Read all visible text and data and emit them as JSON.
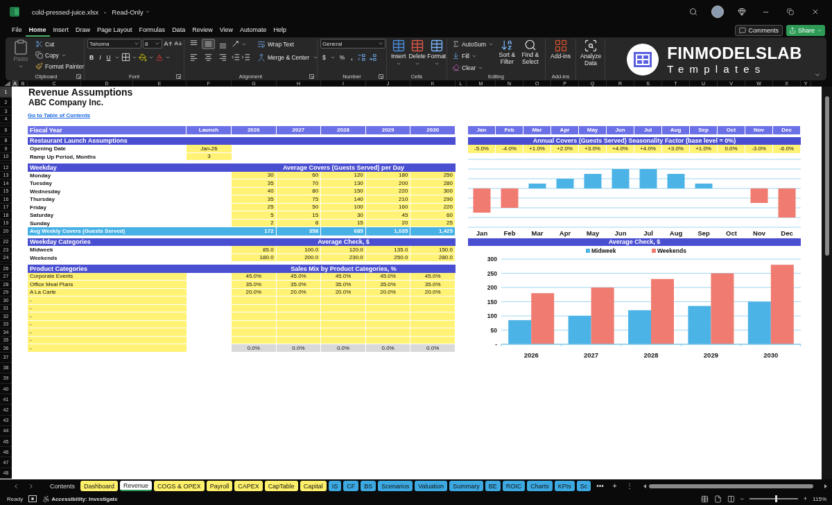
{
  "window": {
    "file_name": "cold-pressed-juice.xlsx",
    "separator": "-",
    "mode": "Read-Only"
  },
  "menu_tabs": [
    {
      "label": "File",
      "selected": false
    },
    {
      "label": "Home",
      "selected": true
    },
    {
      "label": "Insert",
      "selected": false
    },
    {
      "label": "Draw",
      "selected": false
    },
    {
      "label": "Page Layout",
      "selected": false
    },
    {
      "label": "Formulas",
      "selected": false
    },
    {
      "label": "Data",
      "selected": false
    },
    {
      "label": "Review",
      "selected": false
    },
    {
      "label": "View",
      "selected": false
    },
    {
      "label": "Automate",
      "selected": false
    },
    {
      "label": "Help",
      "selected": false
    }
  ],
  "actions": {
    "comments": "Comments",
    "share": "Share"
  },
  "ribbon": {
    "clipboard": {
      "paste": {
        "label": "Paste",
        "disabled": true
      },
      "cut": "Cut",
      "copy": "Copy",
      "format_painter": "Format Painter",
      "label": "Clipboard"
    },
    "font": {
      "name": "Tahoma",
      "size": "8",
      "bold": "B",
      "italic": "I",
      "underline": "U",
      "label": "Font"
    },
    "alignment": {
      "buttons": [
        {
          "kind": "top",
          "selected": false
        },
        {
          "kind": "middle",
          "selected": true
        },
        {
          "kind": "bottom",
          "selected": false
        },
        {
          "kind": "left",
          "selected": false
        },
        {
          "kind": "center",
          "selected": false
        },
        {
          "kind": "right",
          "selected": false
        }
      ],
      "wrap_text": "Wrap Text",
      "merge_center": "Merge & Center",
      "label": "Alignment"
    },
    "number": {
      "format": "General",
      "currency": "$",
      "percent": "%",
      "comma": ",",
      "label": "Number"
    },
    "cells": {
      "insert": "Insert",
      "delete": "Delete",
      "format": "Format",
      "label": "Cells"
    },
    "editing": {
      "autosum": "AutoSum",
      "fill": "Fill",
      "clear": "Clear",
      "sort": "Sort & Filter",
      "find": "Find & Select",
      "label": "Editing"
    },
    "addins": {
      "button": "Add-ins",
      "label": "Add-ins"
    },
    "analyze": "Analyze Data"
  },
  "brand": {
    "name": "FINMODELSLAB",
    "tagline": "Templates"
  },
  "column_headers": [
    {
      "label": "A",
      "selected": true
    },
    {
      "label": "B",
      "selected": false
    },
    {
      "label": "C",
      "selected": false
    },
    {
      "label": "D",
      "selected": false
    },
    {
      "label": "E",
      "selected": false
    },
    {
      "label": "F",
      "selected": false
    },
    {
      "label": "G",
      "selected": false
    },
    {
      "label": "H",
      "selected": false
    },
    {
      "label": "I",
      "selected": false
    },
    {
      "label": "J",
      "selected": false
    },
    {
      "label": "K",
      "selected": false
    },
    {
      "label": "L",
      "selected": false
    },
    {
      "label": "M",
      "selected": false
    },
    {
      "label": "N",
      "selected": false
    },
    {
      "label": "O",
      "selected": false
    },
    {
      "label": "P",
      "selected": false
    },
    {
      "label": "Q",
      "selected": false
    },
    {
      "label": "R",
      "selected": false
    },
    {
      "label": "S",
      "selected": false
    },
    {
      "label": "T",
      "selected": false
    },
    {
      "label": "U",
      "selected": false
    },
    {
      "label": "V",
      "selected": false
    },
    {
      "label": "W",
      "selected": false
    },
    {
      "label": "X",
      "selected": false
    },
    {
      "label": "Y",
      "selected": false
    }
  ],
  "rows": [
    {
      "kind": "title",
      "number": "1",
      "selected": true
    },
    {
      "kind": "subtitle",
      "number": "2",
      "selected": false
    },
    {
      "kind": "normal",
      "number": "3",
      "selected": false
    },
    {
      "kind": "normal",
      "number": "4",
      "selected": false
    },
    {
      "kind": "spacer",
      "selected": false
    },
    {
      "kind": "normal",
      "number": "6",
      "selected": false
    },
    {
      "kind": "spacer",
      "selected": false
    },
    {
      "kind": "normal",
      "number": "8",
      "selected": false
    },
    {
      "kind": "normal",
      "number": "9",
      "selected": false
    },
    {
      "kind": "normal",
      "number": "10",
      "selected": false
    },
    {
      "kind": "spacer",
      "selected": false
    },
    {
      "kind": "normal",
      "number": "12",
      "selected": false
    },
    {
      "kind": "normal",
      "number": "13",
      "selected": false
    },
    {
      "kind": "normal",
      "number": "14",
      "selected": false
    },
    {
      "kind": "normal",
      "number": "15",
      "selected": false
    },
    {
      "kind": "normal",
      "number": "16",
      "selected": false
    },
    {
      "kind": "normal",
      "number": "17",
      "selected": false
    },
    {
      "kind": "normal",
      "number": "18",
      "selected": false
    },
    {
      "kind": "normal",
      "number": "19",
      "selected": false
    },
    {
      "kind": "normal",
      "number": "20",
      "selected": false
    },
    {
      "kind": "spacer",
      "selected": false
    },
    {
      "kind": "normal",
      "number": "22",
      "selected": false
    },
    {
      "kind": "normal",
      "number": "23",
      "selected": false
    },
    {
      "kind": "normal",
      "number": "24",
      "selected": false
    },
    {
      "kind": "spacer",
      "selected": false
    },
    {
      "kind": "normal",
      "number": "26",
      "selected": false
    },
    {
      "kind": "normal",
      "number": "27",
      "selected": false
    },
    {
      "kind": "normal",
      "number": "28",
      "selected": false
    },
    {
      "kind": "normal",
      "number": "29",
      "selected": false
    },
    {
      "kind": "normal",
      "number": "30",
      "selected": false
    },
    {
      "kind": "normal",
      "number": "31",
      "selected": false
    },
    {
      "kind": "normal",
      "number": "32",
      "selected": false
    },
    {
      "kind": "normal",
      "number": "33",
      "selected": false
    },
    {
      "kind": "normal",
      "number": "34",
      "selected": false
    },
    {
      "kind": "normal",
      "number": "35",
      "selected": false
    },
    {
      "kind": "normal",
      "number": "36",
      "selected": false
    },
    {
      "kind": "tall",
      "number": "37",
      "selected": false
    },
    {
      "kind": "tall",
      "number": "38",
      "selected": false
    },
    {
      "kind": "tall",
      "number": "39",
      "selected": false
    },
    {
      "kind": "tall",
      "number": "40",
      "selected": false
    },
    {
      "kind": "tall",
      "number": "41",
      "selected": false
    },
    {
      "kind": "tall",
      "number": "42",
      "selected": false
    },
    {
      "kind": "tall",
      "number": "43",
      "selected": false
    },
    {
      "kind": "tall",
      "number": "44",
      "selected": false
    },
    {
      "kind": "tall",
      "number": "45",
      "selected": false
    },
    {
      "kind": "tall",
      "number": "46",
      "selected": false
    },
    {
      "kind": "tall",
      "number": "47",
      "selected": false
    },
    {
      "kind": "tall",
      "number": "48",
      "selected": false
    }
  ],
  "sheet": {
    "title": "Revenue Assumptions",
    "company": "ABC Company Inc.",
    "toc_link": "Go to Table of Contents",
    "fiscal_header": {
      "label": "Fiscal Year",
      "launch": "Launch",
      "years": [
        "2026",
        "2027",
        "2028",
        "2029",
        "2030"
      ]
    },
    "launch": {
      "title": "Restaurant Launch Assumptions",
      "items": [
        {
          "label": "Opening Date",
          "value": "Jan-26"
        },
        {
          "label": "Ramp Up Period, Months",
          "value": "3"
        }
      ]
    },
    "covers": {
      "title": "Weekday",
      "heading": "Average Covers (Guests Served) per Day",
      "rows": [
        {
          "label": "Monday",
          "values": [
            "30",
            "60",
            "120",
            "180",
            "250"
          ]
        },
        {
          "label": "Tuesday",
          "values": [
            "35",
            "70",
            "130",
            "200",
            "280"
          ]
        },
        {
          "label": "Wednesday",
          "values": [
            "40",
            "80",
            "150",
            "220",
            "300"
          ]
        },
        {
          "label": "Thursday",
          "values": [
            "35",
            "75",
            "140",
            "210",
            "290"
          ]
        },
        {
          "label": "Friday",
          "values": [
            "25",
            "50",
            "100",
            "160",
            "220"
          ]
        },
        {
          "label": "Saturday",
          "values": [
            "5",
            "15",
            "30",
            "45",
            "60"
          ]
        },
        {
          "label": "Sunday",
          "values": [
            "2",
            "8",
            "15",
            "20",
            "25"
          ]
        }
      ],
      "total": {
        "label": "Avg Weekly Covers (Guests Served)",
        "values": [
          "172",
          "358",
          "685",
          "1,035",
          "1,425"
        ]
      }
    },
    "check": {
      "title": "Weekday Categories",
      "heading": "Average Check, $",
      "rows": [
        {
          "label": "Midweek",
          "values": [
            "85.0",
            "100.0",
            "120.0",
            "135.0",
            "150.0"
          ]
        },
        {
          "label": "Weekends",
          "values": [
            "180.0",
            "200.0",
            "230.0",
            "250.0",
            "280.0"
          ]
        }
      ]
    },
    "mix": {
      "title": "Product Categories",
      "heading": "Sales Mix by Product Categories, %",
      "rows": [
        {
          "label": "Corporate Events",
          "values": [
            "45.0%",
            "45.0%",
            "45.0%",
            "45.0%",
            "45.0%"
          ]
        },
        {
          "label": "Office Meal Plans",
          "values": [
            "35.0%",
            "35.0%",
            "35.0%",
            "35.0%",
            "35.0%"
          ]
        },
        {
          "label": "A La Carte",
          "values": [
            "20.0%",
            "20.0%",
            "20.0%",
            "20.0%",
            "20.0%"
          ]
        },
        {
          "label": "-"
        },
        {
          "label": "-"
        },
        {
          "label": "-"
        },
        {
          "label": "-"
        },
        {
          "label": "-"
        },
        {
          "label": "-"
        }
      ],
      "total_row": {
        "label": "-",
        "values": [
          "0.0%",
          "0.0%",
          "0.0%",
          "0.0%",
          "0.0%"
        ]
      }
    }
  },
  "seasonality": {
    "months": [
      "Jan",
      "Feb",
      "Mar",
      "Apr",
      "May",
      "Jun",
      "Jul",
      "Aug",
      "Sep",
      "Oct",
      "Nov",
      "Dec"
    ],
    "title": "Annual Covers (Guests Served) Seasonality Factor (base level = 0%)",
    "factors": [
      "-5.0%",
      "-4.0%",
      "+1.0%",
      "+2.0%",
      "+3.0%",
      "+4.0%",
      "+4.0%",
      "+3.0%",
      "+1.0%",
      "0.0%",
      "-3.0%",
      "-6.0%"
    ],
    "chart_labels": [
      "Jan",
      "Feb",
      "Mar",
      "Apr",
      "May",
      "Jun",
      "Jul",
      "Aug",
      "Sep",
      "Oct",
      "Nov",
      "Dec"
    ]
  },
  "avg_check_chart": {
    "title": "Average Check, $",
    "chart_data": {
      "type": "bar",
      "categories": [
        "2026",
        "2027",
        "2028",
        "2029",
        "2030"
      ],
      "series": [
        {
          "name": "Midweek",
          "color": "#4cb3e6",
          "values": [
            85,
            100,
            120,
            135,
            150
          ]
        },
        {
          "name": "Weekends",
          "color": "#f07b70",
          "values": [
            180,
            200,
            230,
            250,
            280
          ]
        }
      ],
      "ylim": [
        0,
        300
      ],
      "grid": true,
      "legend": true,
      "yticks": [
        {
          "value": 0,
          "label": "-"
        },
        50,
        100,
        150,
        200,
        250,
        300
      ]
    }
  },
  "sheet_tabs": [
    {
      "label": "Contents",
      "selected": false
    },
    {
      "label": "Dashboard",
      "color": "#fff06b",
      "selected": false
    },
    {
      "label": "Revenue",
      "selected": true
    },
    {
      "label": "COGS & OPEX",
      "color": "#fff06b",
      "selected": false
    },
    {
      "label": "Payroll",
      "color": "#fff06b",
      "selected": false
    },
    {
      "label": "CAPEX",
      "color": "#fff06b",
      "selected": false
    },
    {
      "label": "CapTable",
      "color": "#fff06b",
      "selected": false
    },
    {
      "label": "Capital",
      "color": "#fff06b",
      "selected": false
    },
    {
      "label": "IS",
      "color": "#3ca9e2",
      "selected": false
    },
    {
      "label": "CF",
      "color": "#3ca9e2",
      "selected": false
    },
    {
      "label": "BS",
      "color": "#3ca9e2",
      "selected": false
    },
    {
      "label": "Scenarios",
      "color": "#3ca9e2",
      "selected": false
    },
    {
      "label": "Valuation",
      "color": "#3ca9e2",
      "selected": false
    },
    {
      "label": "Summary",
      "color": "#3ca9e2",
      "selected": false
    },
    {
      "label": "BE",
      "color": "#3ca9e2",
      "selected": false
    },
    {
      "label": "ROIC",
      "color": "#3ca9e2",
      "selected": false
    },
    {
      "label": "Charts",
      "color": "#3ca9e2",
      "selected": false
    },
    {
      "label": "KPIs",
      "color": "#3ca9e2",
      "selected": false
    },
    {
      "label": "Sc",
      "color": "#3ca9e2",
      "selected": false
    }
  ],
  "tab_controls": {
    "more": "•••",
    "add": "+",
    "options": "⋮"
  },
  "status_bar": {
    "ready": "Ready",
    "accessibility": "Accessibility: Investigate",
    "zoom_out": "−",
    "zoom_in": "+",
    "zoom_slider": {
      "level": 0.55
    },
    "zoom": "115%"
  }
}
